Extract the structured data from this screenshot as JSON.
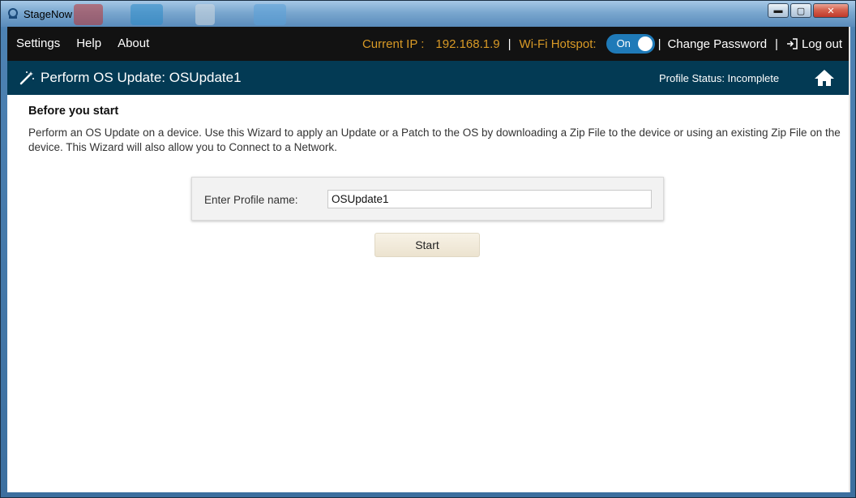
{
  "window": {
    "title": "StageNow",
    "buttons": {
      "minimize": "▬",
      "maximize": "▢",
      "close": "✕"
    }
  },
  "topnav": {
    "menu": [
      "Settings",
      "Help",
      "About"
    ],
    "current_ip_label": "Current IP :",
    "current_ip": "192.168.1.9",
    "wifi_label": "Wi-Fi Hotspot:",
    "wifi_state": "On",
    "separator": "|",
    "change_password": "Change Password",
    "logout": "Log out"
  },
  "header": {
    "title": "Perform OS Update: OSUpdate1",
    "profile_status": "Profile Status: Incomplete"
  },
  "content": {
    "heading": "Before you start",
    "description": "Perform an OS Update on a device.  Use this Wizard to apply an Update or a Patch to the OS by downloading a Zip File to the device or using an existing Zip File on the device.  This Wizard will also allow you to Connect to a Network.",
    "profile_label": "Enter Profile name:",
    "profile_value": "OSUpdate1",
    "start_label": "Start"
  },
  "colors": {
    "accent_orange": "#d99a26",
    "header_blue": "#033a54",
    "toggle_blue": "#1f7ab8"
  }
}
